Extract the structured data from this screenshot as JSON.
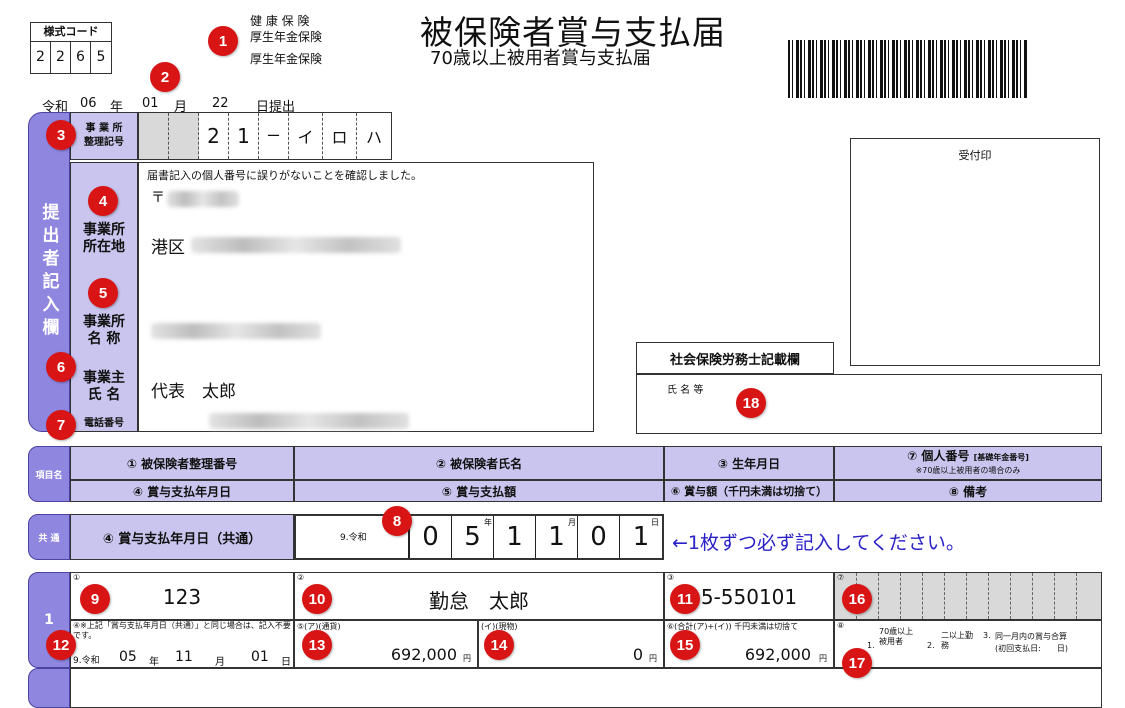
{
  "form_code": {
    "label": "様式コード",
    "digits": [
      "2",
      "2",
      "6",
      "5"
    ]
  },
  "insurance_types": [
    "健 康 保 険",
    "厚生年金保険",
    "厚生年金保険"
  ],
  "title": "被保険者賞与支払届",
  "subtitle": "70歳以上被用者賞与支払届",
  "submit_date": {
    "era": "令和",
    "year": "06",
    "year_unit": "年",
    "month": "01",
    "month_unit": "月",
    "day": "22",
    "suffix": "日提出"
  },
  "office_code": {
    "label": "事 業 所\n整理記号",
    "chars": [
      "",
      "",
      "2",
      "1",
      "ー",
      "イ",
      "ロ",
      "ハ"
    ]
  },
  "submitter": {
    "band_label": "提出者記入欄",
    "confirm_note": "届書記入の個人番号に誤りがないことを確認しました。",
    "postal_mark": "〒",
    "address_label": "事業所\n所在地",
    "address_prefix": "港区",
    "name_label": "事業所\n名 称",
    "owner_label": "事業主\n氏 名",
    "owner_name": "代表　太郎",
    "phone_label": "電話番号"
  },
  "receipt_label": "受付印",
  "sharoushi": {
    "label": "社会保険労務士記載欄",
    "name_label": "氏 名 等"
  },
  "items_header": {
    "band_label": "項目名",
    "row1": [
      "① 被保険者整理番号",
      "② 被保険者氏名",
      "③ 生年月日",
      "⑦ 個人番号"
    ],
    "row1_extra": "[基礎年金番号]",
    "row1_note": "※70歳以上被用者の場合のみ",
    "row2": [
      "④ 賞与支払年月日",
      "⑤ 賞与支払額",
      "⑥ 賞与額（千円未満は切捨て）",
      "⑧ 備考"
    ]
  },
  "common": {
    "band_label": "共 通",
    "label": "④ 賞与支払年月日（共通）",
    "era_code": "9.令和",
    "digits": [
      "0",
      "5",
      "1",
      "1",
      "0",
      "1"
    ],
    "units": [
      "年",
      "月",
      "日"
    ],
    "note": "←1枚ずつ必ず記入してください。"
  },
  "row1": {
    "index": "1",
    "num_marks": [
      "①",
      "②",
      "③",
      "⑦",
      "④",
      "⑤",
      "⑥",
      "⑧"
    ],
    "insured_number": "123",
    "insured_name": "勤怠　太郎",
    "birth_date": "5-550101",
    "pay_date_note": "④※上記「賞与支払年月日（共通）」と同じ場合は、記入不要です。",
    "pay_date": {
      "era": "9.令和",
      "year": "05",
      "year_unit": "年",
      "month": "11",
      "month_unit": "月",
      "day": "01",
      "day_unit": "日"
    },
    "cash_label": "⑤(ア)(通貨)",
    "cash_amount": "692,000",
    "goods_label": "(イ)(現物)",
    "goods_amount": "0",
    "total_label": "⑥(合計(ア)+(イ)) 千円未満は切捨て",
    "total_amount": "692,000",
    "yen": "円",
    "remarks": {
      "opt1_num": "1.",
      "opt1": "70歳以上被用者",
      "opt2_num": "2.",
      "opt2": "二以上勤務",
      "opt3_num": "3.",
      "opt3": "同一月内の賞与合算",
      "opt3_note": "(初回支払日:　　日)"
    }
  },
  "markers": [
    "1",
    "2",
    "3",
    "4",
    "5",
    "6",
    "7",
    "8",
    "9",
    "10",
    "11",
    "12",
    "13",
    "14",
    "15",
    "16",
    "17",
    "18"
  ]
}
